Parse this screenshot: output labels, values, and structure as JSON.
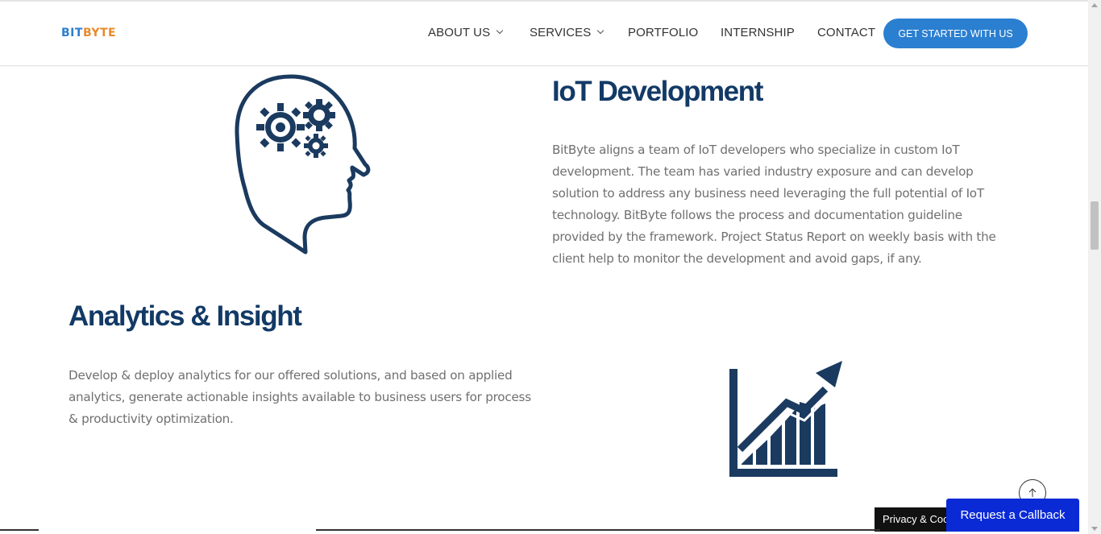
{
  "header": {
    "logo": {
      "part1": "BIT",
      "part2": "BYTE"
    },
    "nav": [
      {
        "label": "ABOUT US",
        "dropdown": true
      },
      {
        "label": "SERVICES",
        "dropdown": true
      },
      {
        "label": "PORTFOLIO",
        "dropdown": false
      },
      {
        "label": "INTERNSHIP",
        "dropdown": false
      },
      {
        "label": "CONTACT",
        "dropdown": false
      }
    ],
    "cta_label": "GET STARTED WITH US"
  },
  "sections": {
    "iot": {
      "title": "IoT Development",
      "icon": "head-gears-icon",
      "lines": [
        "BitByte aligns a team of IoT developers who specialize in custom IoT",
        "development. The team has varied industry exposure and can develop",
        "solution to address any business need leveraging the full potential of IoT",
        "technology. BitByte follows the process and documentation guideline",
        "provided by the framework. Project Status Report on weekly basis with the",
        "client help to monitor the development and avoid gaps, if any."
      ]
    },
    "analytics": {
      "title": "Analytics & Insight",
      "icon": "growth-chart-icon",
      "lines": [
        "Develop & deploy analytics for our offered solutions, and based on applied",
        "analytics, generate actionable insights available to business users for process",
        "& productivity optimization."
      ]
    }
  },
  "widgets": {
    "privacy_label": "Privacy & Cookies Policy",
    "callback_label": "Request a Callback",
    "back_to_top_icon": "arrow-up-icon"
  },
  "colors": {
    "brand_blue": "#2b7fd0",
    "brand_orange": "#e88a2e",
    "heading_navy": "#133a66",
    "callback_blue": "#0a2ad6"
  }
}
